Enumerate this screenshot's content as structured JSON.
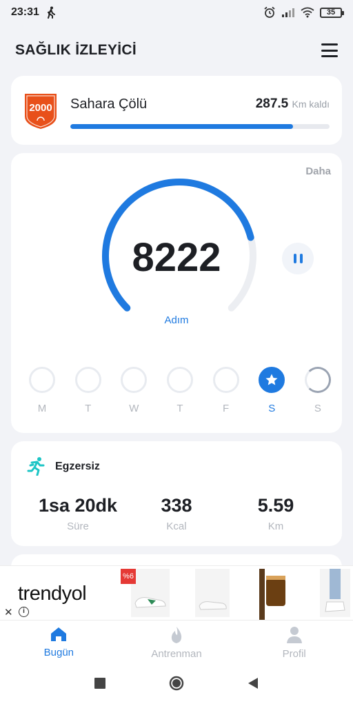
{
  "status_bar": {
    "time": "23:31",
    "battery": "35"
  },
  "header": {
    "title": "SAĞLIK İZLEYİCİ"
  },
  "challenge": {
    "badge_text": "2000",
    "name": "Sahara Çölü",
    "remaining": "287.5",
    "remaining_unit": "Km kaldı",
    "progress": 0.86
  },
  "steps": {
    "more_label": "Daha",
    "count": "8222",
    "label": "Adım",
    "ring_progress": 0.78
  },
  "week": [
    {
      "label": "M",
      "state": "empty"
    },
    {
      "label": "T",
      "state": "empty"
    },
    {
      "label": "W",
      "state": "empty"
    },
    {
      "label": "T",
      "state": "empty"
    },
    {
      "label": "F",
      "state": "empty"
    },
    {
      "label": "S",
      "state": "done"
    },
    {
      "label": "S",
      "state": "partial"
    }
  ],
  "exercise": {
    "title": "Egzersiz",
    "stats": [
      {
        "value": "1sa 20dk",
        "label": "Süre"
      },
      {
        "value": "338",
        "label": "Kcal"
      },
      {
        "value": "5.59",
        "label": "Km"
      }
    ]
  },
  "ad": {
    "brand": "trendyol",
    "discount": "%6"
  },
  "nav": [
    {
      "label": "Bugün",
      "icon": "home-icon",
      "active": true
    },
    {
      "label": "Antrenman",
      "icon": "flame-icon",
      "active": false
    },
    {
      "label": "Profil",
      "icon": "person-icon",
      "active": false
    }
  ],
  "colors": {
    "accent": "#1f7ae0",
    "muted": "#b2b6bd",
    "badge": "#e8501a"
  }
}
